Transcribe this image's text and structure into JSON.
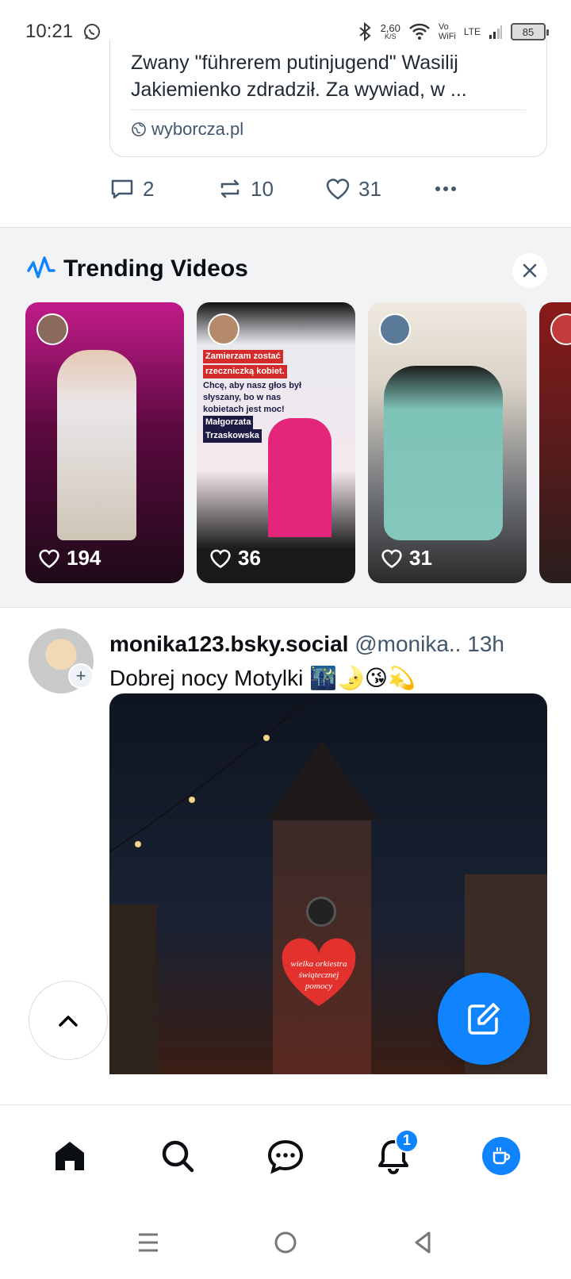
{
  "status_bar": {
    "time": "10:21",
    "net_speed": "2,60",
    "net_unit": "K/S",
    "vo": "Vo",
    "wifi": "WiFi",
    "lte": "LTE",
    "battery": "85"
  },
  "previous_post": {
    "link_description": "Zwany \"führerem putinjugend\" Wasilij Jakiemienko zdradził. Za wywiad, w ...",
    "link_domain": "wyborcza.pl",
    "replies": "2",
    "reposts": "10",
    "likes": "31"
  },
  "trending": {
    "title": "Trending Videos",
    "videos": [
      {
        "likes": "194"
      },
      {
        "likes": "36",
        "banner_red_1": "Zamierzam zostać",
        "banner_red_2": "rzeczniczką kobiet.",
        "banner_text": "Chcę, aby nasz głos był słyszany, bo w nas kobietach jest moc!",
        "banner_name_1": "Małgorzata",
        "banner_name_2": "Trzaskowska"
      },
      {
        "likes": "31"
      }
    ]
  },
  "post": {
    "display_name": "monika123.bsky.social",
    "handle": "@monika..",
    "time": "13h",
    "text": "Dobrej nocy Motylki 🌃🌛😘💫",
    "image_text": "wielka orkiestra świątecznej pomocy"
  },
  "bottom_nav": {
    "notifications_badge": "1"
  },
  "colors": {
    "accent": "#1083fe",
    "muted": "#42576c",
    "section_bg": "#f1f3f5"
  }
}
